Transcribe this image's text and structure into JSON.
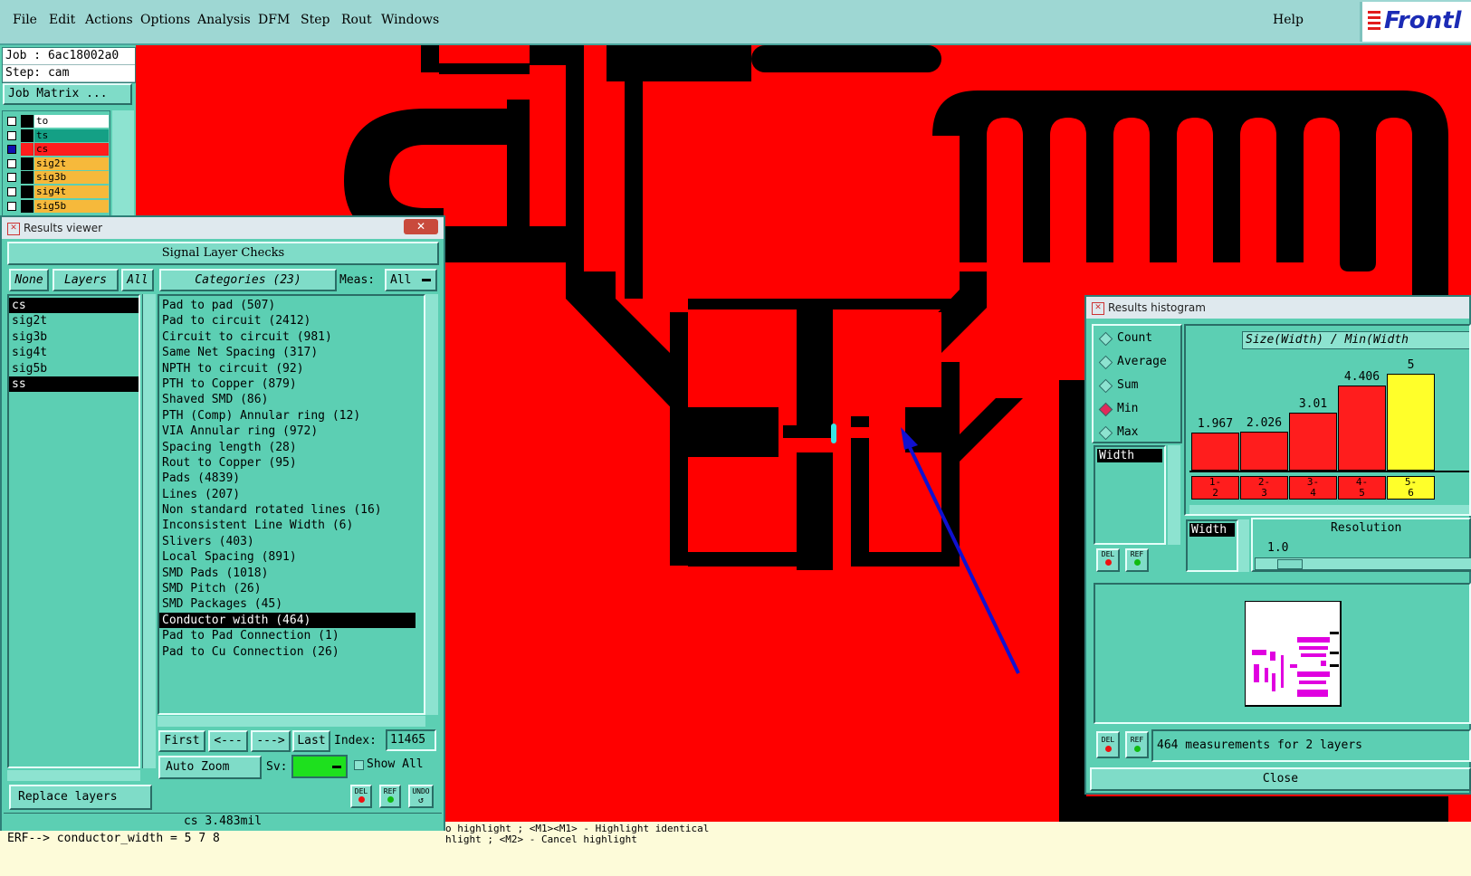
{
  "menubar": {
    "items": [
      "File",
      "Edit",
      "Actions",
      "Options",
      "Analysis",
      "DFM",
      "Step",
      "Rout",
      "Windows"
    ],
    "help": "Help",
    "logo": "Frontl"
  },
  "job": {
    "job_line": "Job : 6ac18002a0",
    "step_line": "Step: cam",
    "matrix_button": "Job Matrix ..."
  },
  "layers": [
    {
      "name": "to",
      "color": "#ffffff"
    },
    {
      "name": "ts",
      "color": "#14a085"
    },
    {
      "name": "cs",
      "color": "#ff1d1d"
    },
    {
      "name": "sig2t",
      "color": "#f6b93b"
    },
    {
      "name": "sig3b",
      "color": "#f6b93b"
    },
    {
      "name": "sig4t",
      "color": "#f6b93b"
    },
    {
      "name": "sig5b",
      "color": "#f6b93b"
    }
  ],
  "results_viewer": {
    "title": "Results viewer",
    "close": "✕",
    "header": "Signal Layer Checks",
    "none_btn": "None",
    "layers_btn": "Layers",
    "all_btn": "All",
    "categories_btn": "Categories (23)",
    "meas_label": "Meas:",
    "meas_value": "All",
    "layer_list": [
      "cs",
      "sig2t",
      "sig3b",
      "sig4t",
      "sig5b",
      "ss"
    ],
    "categories": [
      "Pad to pad (507)",
      "Pad to circuit (2412)",
      "Circuit to circuit (981)",
      "Same Net Spacing (317)",
      "NPTH to circuit (92)",
      "PTH to Copper (879)",
      "Shaved SMD (86)",
      "PTH (Comp) Annular ring (12)",
      "VIA Annular ring (972)",
      "Spacing length (28)",
      "Rout to Copper (95)",
      "Pads (4839)",
      "Lines (207)",
      "Non standard rotated lines (16)",
      "Inconsistent Line Width (6)",
      "Slivers (403)",
      "Local Spacing (891)",
      "SMD Pads (1018)",
      "SMD Pitch (26)",
      "SMD Packages (45)",
      "Conductor width (464)",
      "Pad to Pad Connection (1)",
      "Pad to Cu Connection (26)"
    ],
    "first": "First",
    "prev": "<---",
    "next": "--->",
    "last": "Last",
    "index_label": "Index:",
    "index_value": "11465",
    "zoom": "Auto Zoom",
    "sv_label": "Sv:",
    "show_all": "Show All",
    "replace": "Replace layers",
    "del": "DEL",
    "ref": "REF",
    "undo": "UNDO",
    "status": "cs 3.483mil"
  },
  "console": {
    "line1": "ERF--> conductor_width = 5 7 8",
    "hint1": "o highlight ; <M1><M1> - Highlight identical",
    "hint2": "hlight ; <M2> - Cancel highlight"
  },
  "histogram": {
    "title": "Results histogram",
    "modes": [
      "Count",
      "Average",
      "Sum",
      "Min",
      "Max"
    ],
    "selected_mode": "Min",
    "axis_title": "Size(Width) / Min(Width",
    "field": "Width",
    "field2": "Width",
    "resolution_label": "Resolution",
    "resolution_value": "1.0",
    "summary": "464 measurements for 2 layers",
    "close": "Close",
    "del": "DEL",
    "ref": "REF",
    "bins": [
      "1-\n2",
      "2-\n3",
      "3-\n4",
      "4-\n5",
      "5-\n6"
    ],
    "values": [
      1.967,
      2.026,
      3.01,
      4.406,
      5
    ],
    "value_labels": [
      "1.967",
      "2.026",
      "3.01",
      "4.406",
      "5"
    ],
    "highlight_color": "#ffff2a",
    "bar_color": "#ff1d1d"
  }
}
